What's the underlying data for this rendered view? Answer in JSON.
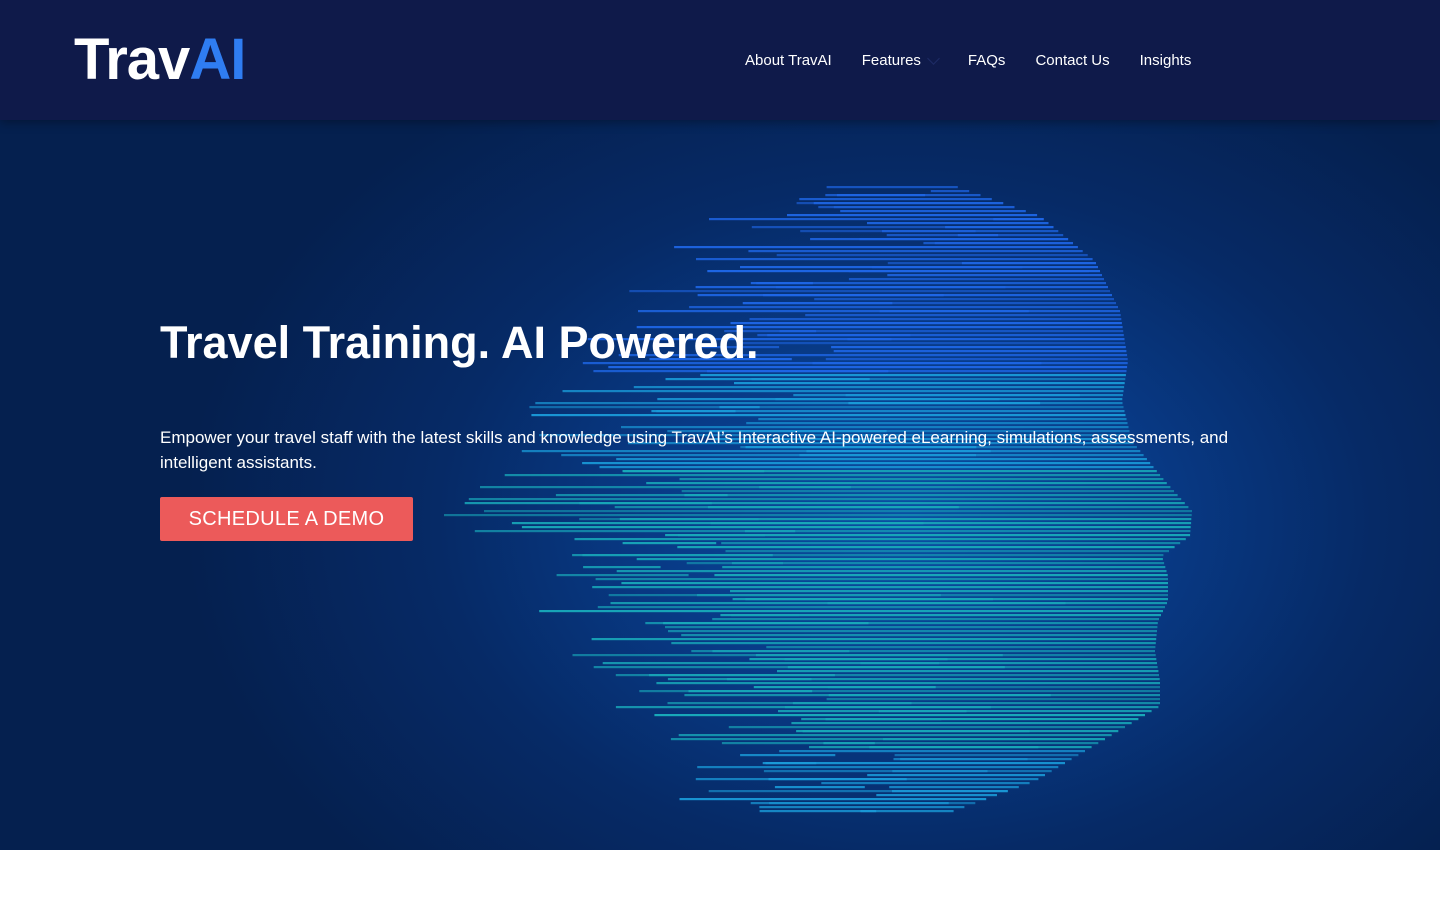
{
  "header": {
    "logo": {
      "part1": "Trav",
      "part2": "AI"
    },
    "nav": [
      {
        "label": "About TravAI"
      },
      {
        "label": "Features"
      },
      {
        "label": "FAQs"
      },
      {
        "label": "Contact Us"
      },
      {
        "label": "Insights"
      }
    ]
  },
  "hero": {
    "title": "Travel Training. AI Powered.",
    "description": "Empower your travel staff with the latest skills and knowledge using TravAI’s Interactive AI-powered eLearning, simulations, assessments, and intelligent assistants.",
    "cta_label": "SCHEDULE A DEMO"
  },
  "colors": {
    "header_bg": "#0f1a4a",
    "hero_bg": "#062a66",
    "logo_accent": "#2f7df2",
    "cta_bg": "#ec5a5a",
    "face_streaks": [
      "#1e66e6",
      "#1a9bd9",
      "#18a8b9"
    ]
  }
}
